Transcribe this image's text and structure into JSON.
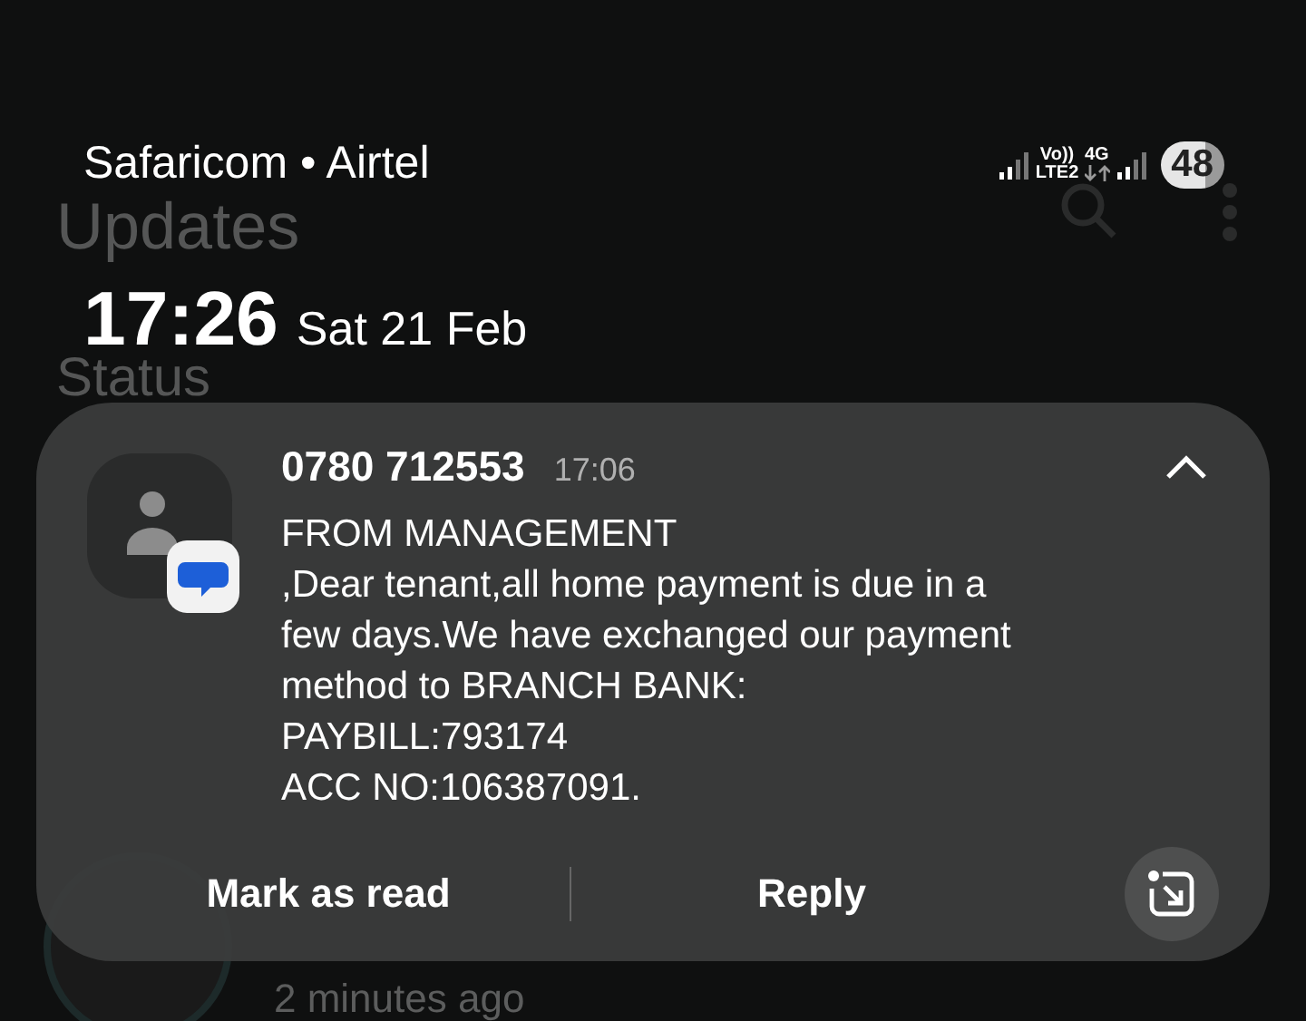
{
  "background_app": {
    "title": "Updates",
    "section": "Status",
    "update_time": "2 minutes ago"
  },
  "status_bar": {
    "carriers": "Safaricom • Airtel",
    "volte": "Vo))",
    "lte": "LTE2",
    "network": "4G",
    "battery": "48"
  },
  "clock": {
    "time": "17:26",
    "date": "Sat 21 Feb"
  },
  "notification": {
    "sender": "0780 712553",
    "time": "17:06",
    "expanded": true,
    "lines": [
      "FROM MANAGEMENT",
      ",Dear tenant,all home payment is due in a few days.We have exchanged our payment method to BRANCH BANK:",
      "PAYBILL:793174",
      "ACC NO:106387091."
    ],
    "actions": [
      "Mark as read",
      "Reply"
    ]
  }
}
